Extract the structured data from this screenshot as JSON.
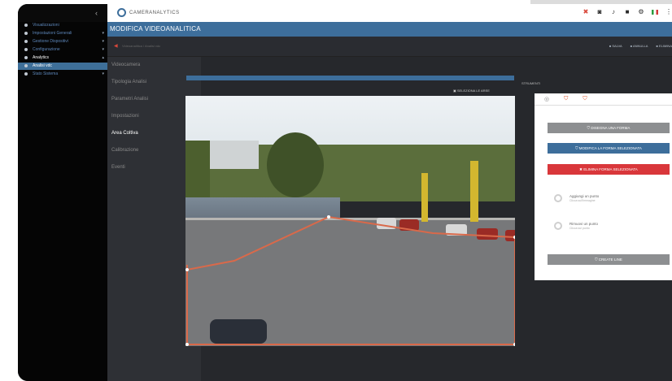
{
  "header": {
    "logo_text": "CAMERANALYTICS"
  },
  "sidebar": {
    "items": [
      {
        "label": "Visualizzazioni",
        "style": "blue"
      },
      {
        "label": "Impostazioni Generali",
        "style": "blue"
      },
      {
        "label": "Gestione Dispositivi",
        "style": "blue"
      },
      {
        "label": "Configurazione",
        "style": "blue"
      },
      {
        "label": "Analytics",
        "style": "sel"
      },
      {
        "label": "Analisi vdc",
        "style": "active"
      },
      {
        "label": "Stato Sistema",
        "style": "blue"
      }
    ]
  },
  "title": "MODIFICA VIDEOANALITICA",
  "subbar": {
    "crumb": "Videoanalitica / Analisi vdc",
    "buttons": [
      "SALVA",
      "ANNULLA",
      "ELIMINA"
    ]
  },
  "menu2": {
    "items": [
      "Videocamera",
      "Tipologia Analisi",
      "Parametri Analisi",
      "Impostazioni",
      "Area Coltiva",
      "Calibrazione",
      "Eventi"
    ],
    "selected_index": 4
  },
  "image_panel": {
    "select_label": "SELEZIONA LE AREE"
  },
  "right_panel": {
    "label": "STRUMENTI",
    "tabs": [
      "◎",
      "⛉",
      "⛉"
    ],
    "buttons": {
      "add": "DISEGNA UNA FORMA",
      "edit": "MODIFICA LA FORMA SELEZIONATA",
      "delete": "ELIMINA FORMA SELEZIONATA"
    },
    "tools": [
      {
        "title": "Aggiungi un punto",
        "subtitle": "Clicca sull'immagine"
      },
      {
        "title": "Rimuovi un punto",
        "subtitle": "Clicca sul punto"
      }
    ],
    "done": "CREATE LINE"
  },
  "colors": {
    "accent_blue": "#3d6e9b",
    "accent_red": "#d9373b",
    "polygon": "#d9694a"
  }
}
